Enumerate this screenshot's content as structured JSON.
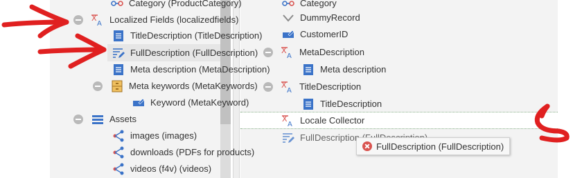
{
  "left_tree": {
    "items": [
      {
        "label": "Category (ProductCategory)",
        "icon": "relation-icon"
      },
      {
        "label": "Localized Fields (localizedfields)",
        "icon": "localized-fields-icon"
      },
      {
        "label": "TitleDescription (TitleDescription)",
        "icon": "text-field-icon"
      },
      {
        "label": "FullDescription (FullDescription)",
        "icon": "wysiwyg-icon"
      },
      {
        "label": "Meta description (MetaDescription)",
        "icon": "text-field-icon"
      },
      {
        "label": "Meta keywords (MetaKeywords)",
        "icon": "fieldcollection-icon"
      },
      {
        "label": "Keyword (MetaKeyword)",
        "icon": "input-icon"
      },
      {
        "label": "Assets",
        "icon": "panel-icon"
      },
      {
        "label": "images (images)",
        "icon": "relation-icon"
      },
      {
        "label": "downloads (PDFs for products)",
        "icon": "relation-icon"
      },
      {
        "label": "videos (f4v) (videos)",
        "icon": "relation-icon"
      }
    ]
  },
  "right_tree": {
    "items": [
      {
        "label": "Category",
        "icon": "relation-icon"
      },
      {
        "label": "DummyRecord",
        "icon": "chevron-down-icon"
      },
      {
        "label": "CustomerID",
        "icon": "input-icon"
      },
      {
        "label": "MetaDescription",
        "icon": "localized-fields-icon"
      },
      {
        "label": "Meta description",
        "icon": "text-field-icon"
      },
      {
        "label": "TitleDescription",
        "icon": "localized-fields-icon"
      },
      {
        "label": "TitleDescription",
        "icon": "text-field-icon"
      },
      {
        "label": "Locale Collector",
        "icon": "localized-fields-icon"
      },
      {
        "label": "FullDescription (FullDescription)",
        "icon": "wysiwyg-icon"
      }
    ]
  },
  "tooltip": {
    "text": "FullDescription (FullDescription)",
    "icon": "error-icon"
  },
  "colors": {
    "annotation": "#e02020",
    "localized": "#d9534f",
    "field": "#3b73c8",
    "collector_border": "#7fa87f"
  }
}
